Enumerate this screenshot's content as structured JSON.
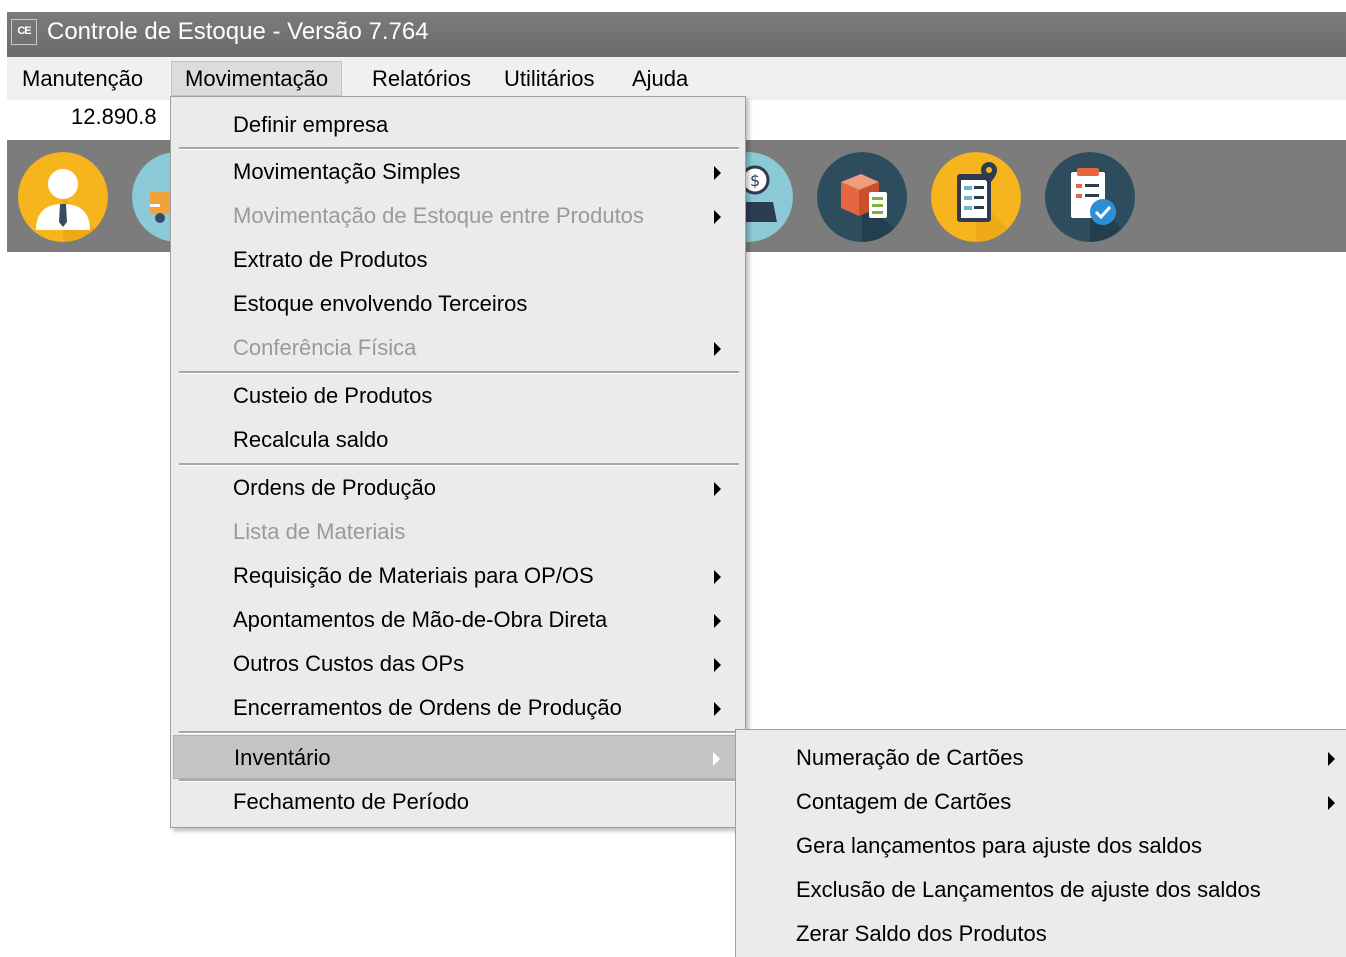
{
  "window": {
    "logo_text": "CE",
    "title": "Controle de Estoque - Versão 7.764"
  },
  "menubar": {
    "items": [
      "Manutenção",
      "Movimentação",
      "Relatórios",
      "Utilitários",
      "Ajuda"
    ],
    "active": "Movimentação"
  },
  "infoline": {
    "value": "12.890.8"
  },
  "toolbar": {
    "icons": [
      "user-icon",
      "truck-icon",
      "money-box-icon",
      "box-checklist-icon",
      "clipboard-location-icon",
      "report-check-icon"
    ]
  },
  "dropdown": {
    "items": [
      {
        "label": "Definir empresa"
      },
      {
        "label": "Movimentação Simples",
        "submenu": true
      },
      {
        "label": "Movimentação de Estoque entre Produtos",
        "submenu": true,
        "disabled": true
      },
      {
        "label": "Extrato de Produtos"
      },
      {
        "label": "Estoque envolvendo Terceiros"
      },
      {
        "label": "Conferência Física",
        "submenu": true,
        "disabled": true
      },
      {
        "label": "Custeio de Produtos"
      },
      {
        "label": "Recalcula saldo"
      },
      {
        "label": "Ordens de Produção",
        "submenu": true
      },
      {
        "label": "Lista de Materiais",
        "disabled": true
      },
      {
        "label": "Requisição de Materiais para OP/OS",
        "submenu": true
      },
      {
        "label": "Apontamentos de Mão-de-Obra Direta",
        "submenu": true
      },
      {
        "label": "Outros Custos das OPs",
        "submenu": true
      },
      {
        "label": "Encerramentos de Ordens de Produção",
        "submenu": true
      },
      {
        "label": "Inventário",
        "submenu": true,
        "highlighted": true
      },
      {
        "label": "Fechamento de Período"
      }
    ]
  },
  "submenu": {
    "items": [
      {
        "label": "Numeração de  Cartões",
        "submenu": true
      },
      {
        "label": "Contagem de Cartões",
        "submenu": true
      },
      {
        "label": "Gera lançamentos para ajuste dos saldos"
      },
      {
        "label": "Exclusão de Lançamentos de ajuste dos saldos"
      },
      {
        "label": "Zerar Saldo dos Produtos"
      }
    ]
  }
}
